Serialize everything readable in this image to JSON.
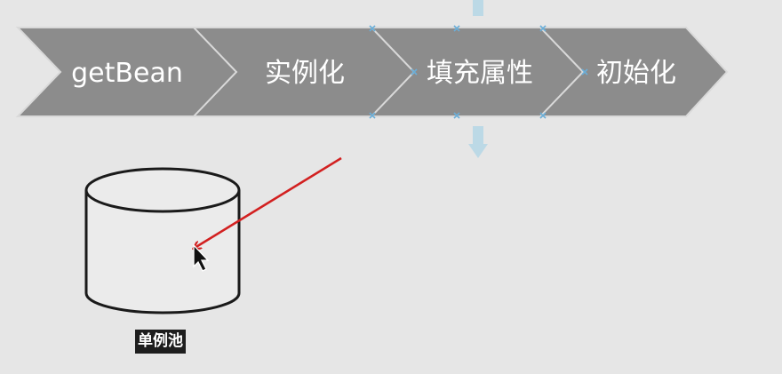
{
  "process_steps": [
    {
      "label": "getBean"
    },
    {
      "label": "实例化"
    },
    {
      "label": "填充属性"
    },
    {
      "label": "初始化"
    }
  ],
  "storage": {
    "label": "单例池"
  },
  "colors": {
    "background": "#e6e6e6",
    "chevron_fill": "#8c8c8c",
    "chevron_text": "#ffffff",
    "pointer_arrow": "#d22020",
    "selection_handles": "#6aaed8",
    "connector_guide": "#bcd9e6"
  }
}
